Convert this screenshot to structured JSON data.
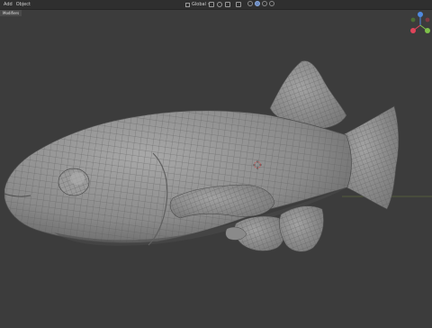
{
  "menu": {
    "items": [
      "Add",
      "Object"
    ]
  },
  "mode_tab": {
    "label": "Modifiers"
  },
  "header": {
    "transform_label": "Global"
  },
  "colors": {
    "background": "#3c3c3c",
    "mesh_fill": "#8c8c8c",
    "wire": "#5f5f5f",
    "axis_x": "#e0445a",
    "axis_y": "#7fc24a",
    "axis_z": "#4f8ae0"
  }
}
